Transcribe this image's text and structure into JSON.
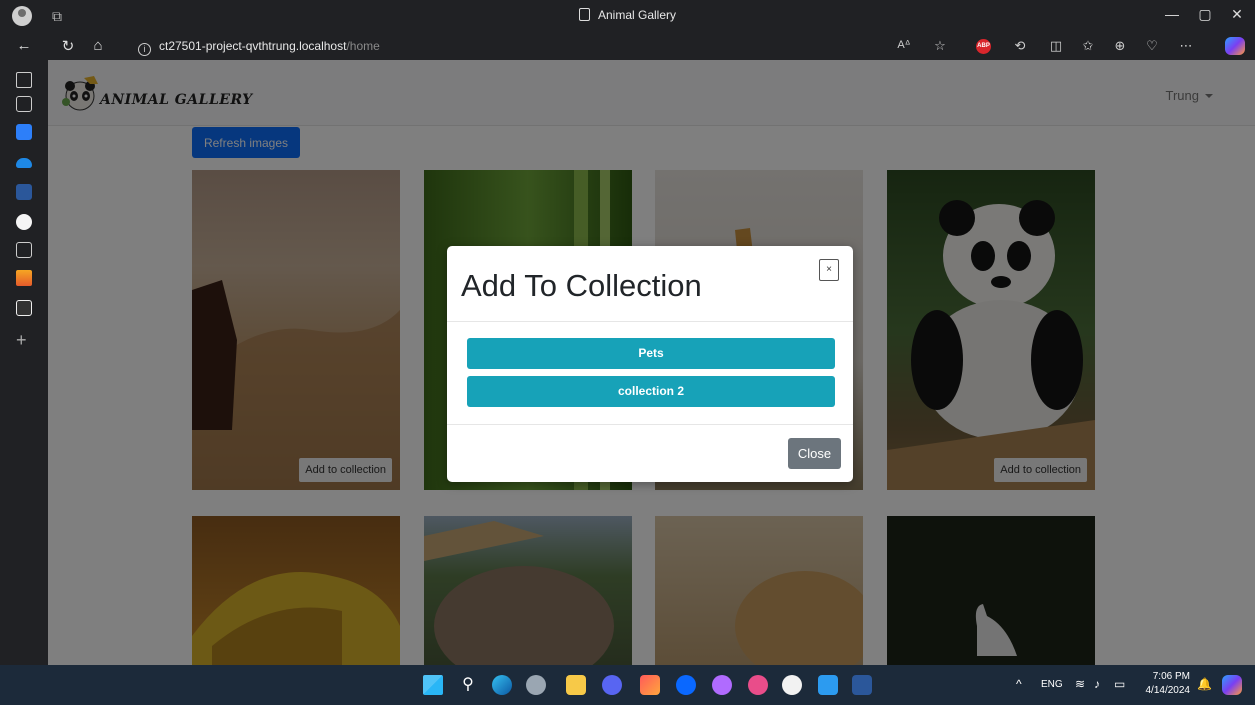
{
  "window": {
    "title": "Animal Gallery",
    "controls": {
      "minimize": "—",
      "maximize": "▢",
      "close": "✕"
    }
  },
  "address_bar": {
    "host": "ct27501-project-qvthtrung.localhost",
    "path": "/home",
    "info_glyph": "i"
  },
  "app": {
    "logo_text": "ANIMAL GALLERY",
    "user_name": "Trung",
    "refresh_label": "Refresh images",
    "add_to_collection_label": "Add to collection"
  },
  "modal": {
    "title": "Add To Collection",
    "close_x": "×",
    "collections": [
      "Pets",
      "collection 2"
    ],
    "close_label": "Close"
  },
  "taskbar": {
    "language": "ENG",
    "time": "7:06 PM",
    "date": "4/14/2024",
    "overflow": "^"
  },
  "colors": {
    "primary": "#0d6efd",
    "info": "#17a2b8",
    "secondary": "#6c757d"
  }
}
